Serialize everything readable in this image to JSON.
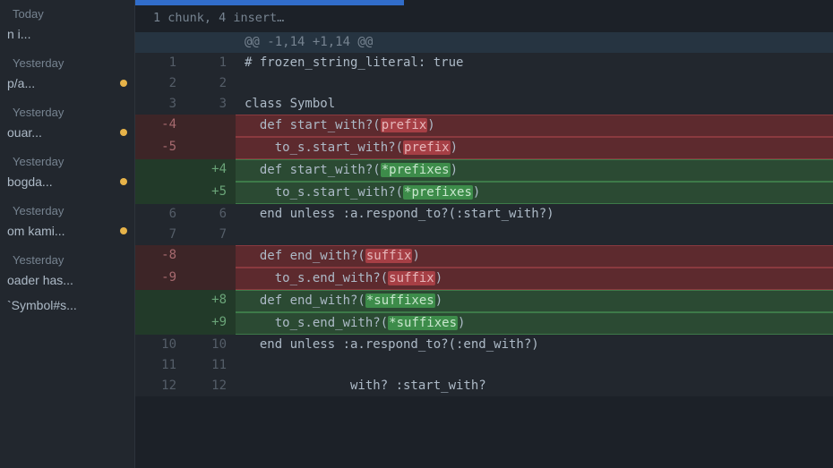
{
  "sidebar": {
    "groups": [
      {
        "label": "Today",
        "items": [
          {
            "text": "n i...",
            "unread": false
          }
        ]
      },
      {
        "label": "Yesterday",
        "items": [
          {
            "text": "p/a...",
            "unread": true
          }
        ]
      },
      {
        "label": "Yesterday",
        "items": [
          {
            "text": "ouar...",
            "unread": true
          }
        ]
      },
      {
        "label": "Yesterday",
        "items": [
          {
            "text": "bogda...",
            "unread": true
          }
        ]
      },
      {
        "label": "Yesterday",
        "items": [
          {
            "text": "om kami...",
            "unread": true
          }
        ]
      },
      {
        "label": "Yesterday",
        "items": [
          {
            "text": "oader has...",
            "unread": false
          }
        ]
      },
      {
        "label": "",
        "items": [
          {
            "text": "`Symbol#s...",
            "unread": false
          }
        ]
      }
    ]
  },
  "diff": {
    "summary": "1 chunk, 4 insert…",
    "lines": [
      {
        "type": "hunk",
        "old": "",
        "new": "",
        "text": "@@ -1,14 +1,14 @@"
      },
      {
        "type": "ctx",
        "old": "1",
        "new": "1",
        "segs": [
          {
            "t": "# frozen_string_literal: true"
          }
        ]
      },
      {
        "type": "ctx",
        "old": "2",
        "new": "2",
        "segs": [
          {
            "t": ""
          }
        ]
      },
      {
        "type": "ctx",
        "old": "3",
        "new": "3",
        "segs": [
          {
            "t": "class Symbol"
          }
        ]
      },
      {
        "type": "del",
        "old": "-4",
        "new": "",
        "segs": [
          {
            "t": "  def start_with?("
          },
          {
            "t": "prefix",
            "hl": "del"
          },
          {
            "t": ")"
          }
        ]
      },
      {
        "type": "del",
        "old": "-5",
        "new": "",
        "segs": [
          {
            "t": "    to_s.start_with?("
          },
          {
            "t": "prefix",
            "hl": "del"
          },
          {
            "t": ")"
          }
        ]
      },
      {
        "type": "add",
        "old": "",
        "new": "+4",
        "segs": [
          {
            "t": "  def start_with?("
          },
          {
            "t": "*prefixes",
            "hl": "add"
          },
          {
            "t": ")"
          }
        ]
      },
      {
        "type": "add",
        "old": "",
        "new": "+5",
        "segs": [
          {
            "t": "    to_s.start_with?("
          },
          {
            "t": "*prefixes",
            "hl": "add"
          },
          {
            "t": ")"
          }
        ]
      },
      {
        "type": "ctx",
        "old": "6",
        "new": "6",
        "segs": [
          {
            "t": "  end unless :a.respond_to?(:start_with?)"
          }
        ]
      },
      {
        "type": "ctx",
        "old": "7",
        "new": "7",
        "segs": [
          {
            "t": ""
          }
        ]
      },
      {
        "type": "del",
        "old": "-8",
        "new": "",
        "segs": [
          {
            "t": "  def end_with?("
          },
          {
            "t": "suffix",
            "hl": "del"
          },
          {
            "t": ")"
          }
        ]
      },
      {
        "type": "del",
        "old": "-9",
        "new": "",
        "segs": [
          {
            "t": "    to_s.end_with?("
          },
          {
            "t": "suffix",
            "hl": "del"
          },
          {
            "t": ")"
          }
        ]
      },
      {
        "type": "add",
        "old": "",
        "new": "+8",
        "segs": [
          {
            "t": "  def end_with?("
          },
          {
            "t": "*suffixes",
            "hl": "add"
          },
          {
            "t": ")"
          }
        ]
      },
      {
        "type": "add",
        "old": "",
        "new": "+9",
        "segs": [
          {
            "t": "    to_s.end_with?("
          },
          {
            "t": "*suffixes",
            "hl": "add"
          },
          {
            "t": ")"
          }
        ]
      },
      {
        "type": "ctx",
        "old": "10",
        "new": "10",
        "segs": [
          {
            "t": "  end unless :a.respond_to?(:end_with?)"
          }
        ]
      },
      {
        "type": "ctx",
        "old": "11",
        "new": "11",
        "segs": [
          {
            "t": ""
          }
        ]
      },
      {
        "type": "ctx",
        "old": "12",
        "new": "12",
        "segs": [
          {
            "t": "              with? :start_with?"
          }
        ]
      }
    ]
  }
}
